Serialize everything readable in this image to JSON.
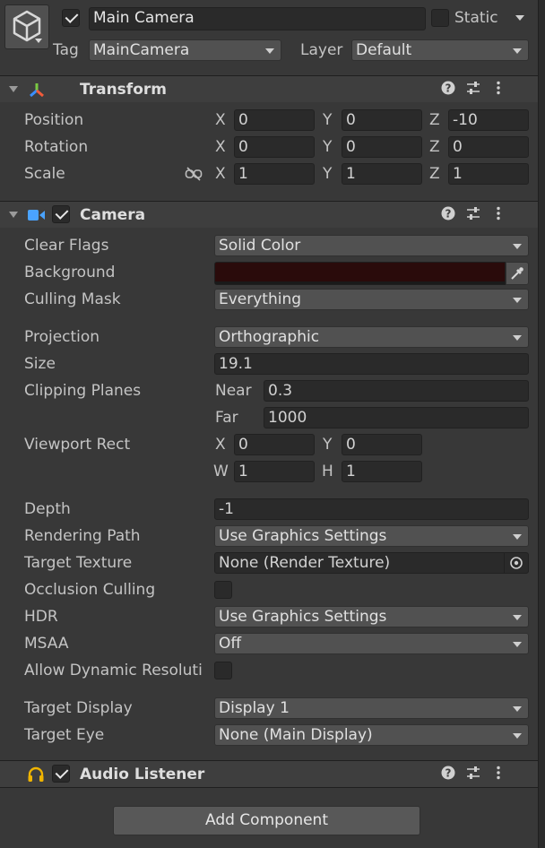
{
  "header": {
    "object_name": "Main Camera",
    "static_label": "Static",
    "tag_label": "Tag",
    "tag_value": "MainCamera",
    "layer_label": "Layer",
    "layer_value": "Default"
  },
  "transform": {
    "title": "Transform",
    "rows": [
      {
        "label": "Position",
        "x": "0",
        "y": "0",
        "z": "-10"
      },
      {
        "label": "Rotation",
        "x": "0",
        "y": "0",
        "z": "0"
      },
      {
        "label": "Scale",
        "x": "1",
        "y": "1",
        "z": "1"
      }
    ],
    "axis": {
      "x": "X",
      "y": "Y",
      "z": "Z"
    }
  },
  "camera": {
    "title": "Camera",
    "clear_flags_label": "Clear Flags",
    "clear_flags_value": "Solid Color",
    "background_label": "Background",
    "background_color": "#2a0b0b",
    "culling_mask_label": "Culling Mask",
    "culling_mask_value": "Everything",
    "projection_label": "Projection",
    "projection_value": "Orthographic",
    "size_label": "Size",
    "size_value": "19.1",
    "clipping_label": "Clipping Planes",
    "near_label": "Near",
    "near_value": "0.3",
    "far_label": "Far",
    "far_value": "1000",
    "viewport_label": "Viewport Rect",
    "vp_x_label": "X",
    "vp_x": "0",
    "vp_y_label": "Y",
    "vp_y": "0",
    "vp_w_label": "W",
    "vp_w": "1",
    "vp_h_label": "H",
    "vp_h": "1",
    "depth_label": "Depth",
    "depth_value": "-1",
    "rendering_path_label": "Rendering Path",
    "rendering_path_value": "Use Graphics Settings",
    "target_texture_label": "Target Texture",
    "target_texture_value": "None (Render Texture)",
    "occlusion_label": "Occlusion Culling",
    "hdr_label": "HDR",
    "hdr_value": "Use Graphics Settings",
    "msaa_label": "MSAA",
    "msaa_value": "Off",
    "dyn_res_label": "Allow Dynamic Resoluti",
    "target_display_label": "Target Display",
    "target_display_value": "Display 1",
    "target_eye_label": "Target Eye",
    "target_eye_value": "None (Main Display)"
  },
  "audio": {
    "title": "Audio Listener"
  },
  "add_component_label": "Add Component",
  "colors": {
    "panel_bg": "#383838",
    "field_bg": "#2a2a2a",
    "dropdown_bg": "#515151",
    "camera_icon": "#4aa3ff",
    "audio_icon": "#f0b400"
  },
  "icons": [
    "cube-icon",
    "transform-axis-icon",
    "camera-icon",
    "headphones-icon",
    "help-icon",
    "presets-icon",
    "kebab-icon",
    "eyedropper-icon",
    "object-picker-icon",
    "link-scale-icon"
  ]
}
